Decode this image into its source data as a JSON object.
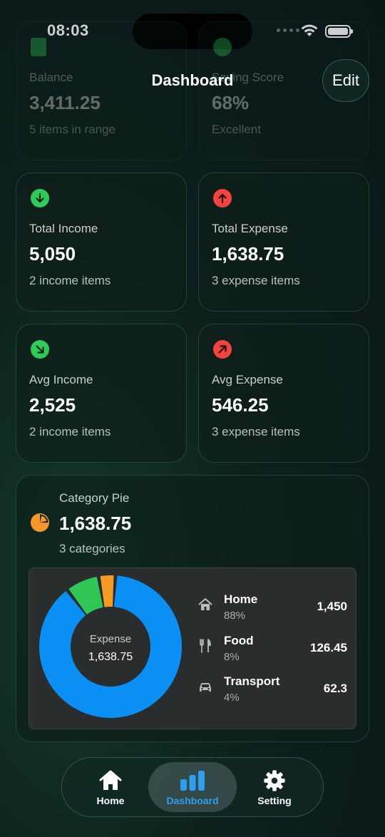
{
  "status": {
    "time": "08:03"
  },
  "header": {
    "title": "Dashboard",
    "edit_label": "Edit"
  },
  "cards": {
    "balance": {
      "label": "Balance",
      "value": "3,411.25",
      "sub": "5 items in range"
    },
    "score": {
      "label": "Saving Score",
      "value": "68%",
      "sub": "Excellent"
    },
    "total_income": {
      "label": "Total Income",
      "value": "5,050",
      "sub": "2 income items"
    },
    "total_expense": {
      "label": "Total Expense",
      "value": "1,638.75",
      "sub": "3 expense items"
    },
    "avg_income": {
      "label": "Avg Income",
      "value": "2,525",
      "sub": "2 income items"
    },
    "avg_expense": {
      "label": "Avg Expense",
      "value": "546.25",
      "sub": "3 expense items"
    }
  },
  "pie": {
    "title": "Category Pie",
    "value": "1,638.75",
    "sub": "3 categories",
    "center_label": "Expense",
    "center_value": "1,638.75",
    "items": [
      {
        "name": "Home",
        "pct": "88%",
        "value": "1,450",
        "icon": "house-icon",
        "color": "#0a8ff5",
        "share": 0.885
      },
      {
        "name": "Food",
        "pct": "8%",
        "value": "126.45",
        "icon": "fork-knife-icon",
        "color": "#30c653",
        "share": 0.077
      },
      {
        "name": "Transport",
        "pct": "4%",
        "value": "62.3",
        "icon": "car-icon",
        "color": "#f59a23",
        "share": 0.038
      }
    ]
  },
  "tabs": {
    "home": "Home",
    "dashboard": "Dashboard",
    "setting": "Setting"
  },
  "colors": {
    "accent": "#2c9ff2",
    "income": "#2fcb5a",
    "expense": "#f2433f",
    "pie_icon": "#f5962a"
  }
}
